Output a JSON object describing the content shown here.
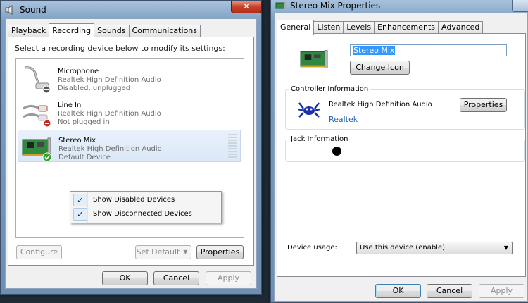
{
  "sound": {
    "title": "Sound",
    "close_glyph": "✕",
    "tabs": [
      "Playback",
      "Recording",
      "Sounds",
      "Communications"
    ],
    "active_tab": "Recording",
    "instruction": "Select a recording device below to modify its settings:",
    "devices": [
      {
        "name": "Microphone",
        "driver": "Realtek High Definition Audio",
        "status": "Disabled, unplugged",
        "icon": "microphone-icon"
      },
      {
        "name": "Line In",
        "driver": "Realtek High Definition Audio",
        "status": "Not plugged in",
        "icon": "line-in-jack-icon"
      },
      {
        "name": "Stereo Mix",
        "driver": "Realtek High Definition Audio",
        "status": "Default Device",
        "icon": "sound-card-icon",
        "selected": true
      }
    ],
    "context_menu": [
      {
        "label": "Show Disabled Devices",
        "checked": true
      },
      {
        "label": "Show Disconnected Devices",
        "checked": true
      }
    ],
    "check_glyph": "✓",
    "buttons": {
      "configure": "Configure",
      "set_default": "Set Default",
      "dropdown_glyph": "▼",
      "properties": "Properties",
      "ok": "OK",
      "cancel": "Cancel",
      "apply": "Apply"
    }
  },
  "props": {
    "title": "Stereo Mix Properties",
    "tabs": [
      "General",
      "Listen",
      "Levels",
      "Enhancements",
      "Advanced"
    ],
    "active_tab": "General",
    "device_name": "Stereo Mix",
    "change_icon": "Change Icon",
    "controller": {
      "heading": "Controller Information",
      "name": "Realtek High Definition Audio",
      "properties": "Properties",
      "vendor_link": "Realtek"
    },
    "jack": {
      "heading": "Jack Information"
    },
    "usage": {
      "label": "Device usage:",
      "value": "Use this device (enable)",
      "arrow": "▼"
    },
    "buttons": {
      "ok": "OK",
      "cancel": "Cancel",
      "apply": "Apply"
    }
  },
  "colors": {
    "accent_link": "#1d65b3",
    "selection": "#3399ff",
    "green_check": "#2fa42c",
    "red_badge": "#c42b1c"
  }
}
